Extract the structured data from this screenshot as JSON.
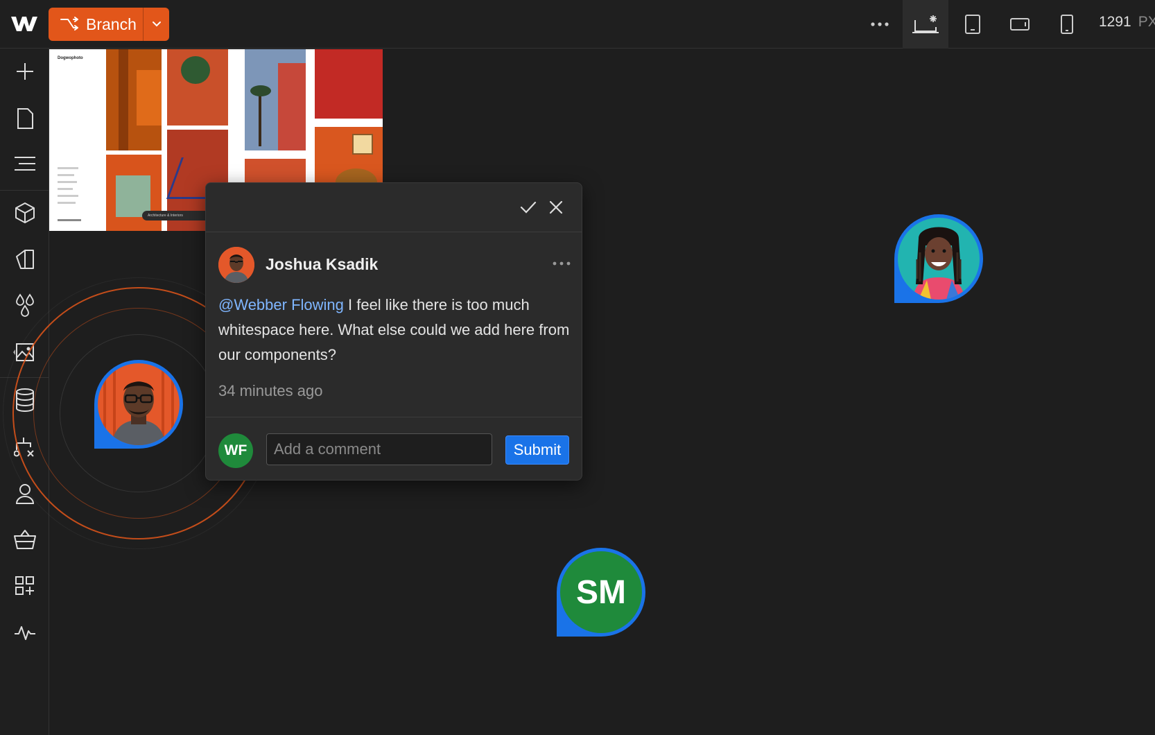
{
  "toolbar": {
    "branch_label": "Branch",
    "width_value": "1291",
    "width_unit": "PX",
    "breakpoints": [
      "desktop-star-icon",
      "tablet-icon",
      "landscape-icon",
      "phone-icon"
    ]
  },
  "sidebar": {
    "items": [
      "plus-icon",
      "page-icon",
      "navigator-icon",
      "cube-icon",
      "style-manager-icon",
      "color-drops-icon",
      "assets-icon",
      "database-icon",
      "logic-icon",
      "users-icon",
      "basket-icon",
      "apps-icon",
      "activity-icon"
    ]
  },
  "thumbnail": {
    "brand": "Dogwophoto",
    "caption": "Architecture & Interiors"
  },
  "comment": {
    "author": "Joshua Ksadik",
    "mention": "@Webber Flowing",
    "body": " I feel like there is too much whitespace here. What else could we add here from our components?",
    "time": "34 minutes ago",
    "reply_initials": "WF",
    "input_placeholder": "Add a comment",
    "submit_label": "Submit"
  },
  "presence": {
    "sm_initials": "SM"
  },
  "colors": {
    "accent_orange": "#e2561a",
    "accent_blue": "#1a73e8",
    "avatar_green": "#1f8a3b",
    "mention_blue": "#7fb6ff",
    "background": "#1e1e1e"
  }
}
